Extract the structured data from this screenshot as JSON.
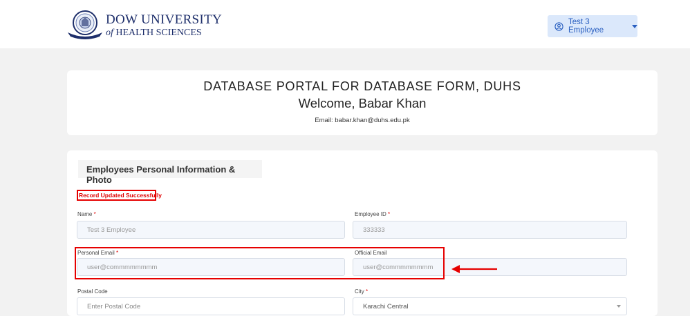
{
  "logo": {
    "line1": "DOW UNIVERSITY",
    "line2_prefix": "of",
    "line2": "HEALTH SCIENCES"
  },
  "user_menu": {
    "label": "Test 3 Employee",
    "color": "#2a5fc0"
  },
  "header": {
    "title": "DATABASE PORTAL FOR DATABASE FORM, DUHS",
    "welcome": "Welcome, Babar Khan",
    "email": "Email: babar.khan@duhs.edu.pk"
  },
  "form": {
    "section_title": "Employees Personal Information & Photo",
    "success_message": "Record Updated Successfully",
    "fields": {
      "name": {
        "label": "Name",
        "required": "*",
        "value": "Test 3 Employee"
      },
      "employee_id": {
        "label": "Employee ID",
        "required": "*",
        "value": "333333"
      },
      "personal_email": {
        "label": "Personal Email",
        "required": "*",
        "value": "user@commmmmmmm"
      },
      "official_email": {
        "label": "Official Email",
        "value": "user@commmmmmmm"
      },
      "postal_code": {
        "label": "Postal Code",
        "placeholder": "Enter Postal Code"
      },
      "city": {
        "label": "City",
        "required": "*",
        "value": "Karachi Central"
      }
    }
  },
  "annotation": {
    "highlight_color": "#e60000"
  }
}
